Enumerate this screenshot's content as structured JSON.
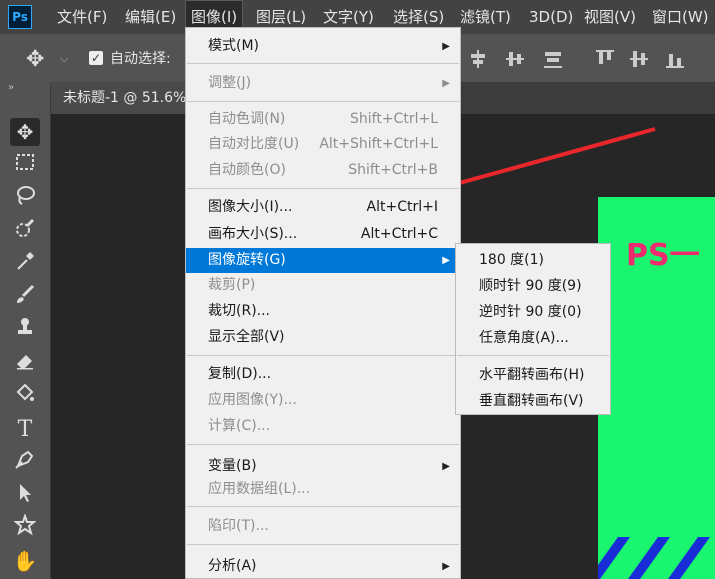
{
  "app": {
    "logo": "Ps"
  },
  "menubar": {
    "items": [
      "文件(F)",
      "编辑(E)",
      "图像(I)",
      "图层(L)",
      "文字(Y)",
      "选择(S)",
      "滤镜(T)",
      "3D(D)",
      "视图(V)",
      "窗口(W)"
    ],
    "active": "图像(I)"
  },
  "options_bar": {
    "auto_select_label": "自动选择:",
    "auto_select_checked": true,
    "icons": [
      "move-icon",
      "chevron-down-icon",
      "align-icon"
    ]
  },
  "document": {
    "tab_title": "未标题-1 @ 51.6%"
  },
  "canvas": {
    "title_text": "PS一",
    "background": "#19f56e",
    "title_color": "#f02a6e",
    "stripe_color": "#1a2cd8"
  },
  "image_menu": {
    "items": [
      {
        "label": "模式(M)",
        "shortcut": "",
        "submenu": true,
        "disabled": false
      },
      {
        "label": "调整(J)",
        "shortcut": "",
        "submenu": true,
        "disabled": true
      },
      {
        "label": "自动色调(N)",
        "shortcut": "Shift+Ctrl+L",
        "submenu": false,
        "disabled": true
      },
      {
        "label": "自动对比度(U)",
        "shortcut": "Alt+Shift+Ctrl+L",
        "submenu": false,
        "disabled": true
      },
      {
        "label": "自动颜色(O)",
        "shortcut": "Shift+Ctrl+B",
        "submenu": false,
        "disabled": true
      },
      {
        "label": "图像大小(I)...",
        "shortcut": "Alt+Ctrl+I",
        "submenu": false,
        "disabled": false
      },
      {
        "label": "画布大小(S)...",
        "shortcut": "Alt+Ctrl+C",
        "submenu": false,
        "disabled": false
      },
      {
        "label": "图像旋转(G)",
        "shortcut": "",
        "submenu": true,
        "disabled": false,
        "highlighted": true
      },
      {
        "label": "裁剪(P)",
        "shortcut": "",
        "submenu": false,
        "disabled": true
      },
      {
        "label": "裁切(R)...",
        "shortcut": "",
        "submenu": false,
        "disabled": false
      },
      {
        "label": "显示全部(V)",
        "shortcut": "",
        "submenu": false,
        "disabled": false
      },
      {
        "label": "复制(D)...",
        "shortcut": "",
        "submenu": false,
        "disabled": false
      },
      {
        "label": "应用图像(Y)...",
        "shortcut": "",
        "submenu": false,
        "disabled": true
      },
      {
        "label": "计算(C)...",
        "shortcut": "",
        "submenu": false,
        "disabled": true
      },
      {
        "label": "变量(B)",
        "shortcut": "",
        "submenu": true,
        "disabled": false
      },
      {
        "label": "应用数据组(L)...",
        "shortcut": "",
        "submenu": false,
        "disabled": true
      },
      {
        "label": "陷印(T)...",
        "shortcut": "",
        "submenu": false,
        "disabled": true
      },
      {
        "label": "分析(A)",
        "shortcut": "",
        "submenu": true,
        "disabled": false
      }
    ]
  },
  "rotate_submenu": {
    "items": [
      "180 度(1)",
      "顺时针 90 度(9)",
      "逆时针 90 度(0)",
      "任意角度(A)...",
      "水平翻转画布(H)",
      "垂直翻转画布(V)"
    ]
  },
  "highlight_color": "#0078d7",
  "annotation_color": "#e8262b"
}
